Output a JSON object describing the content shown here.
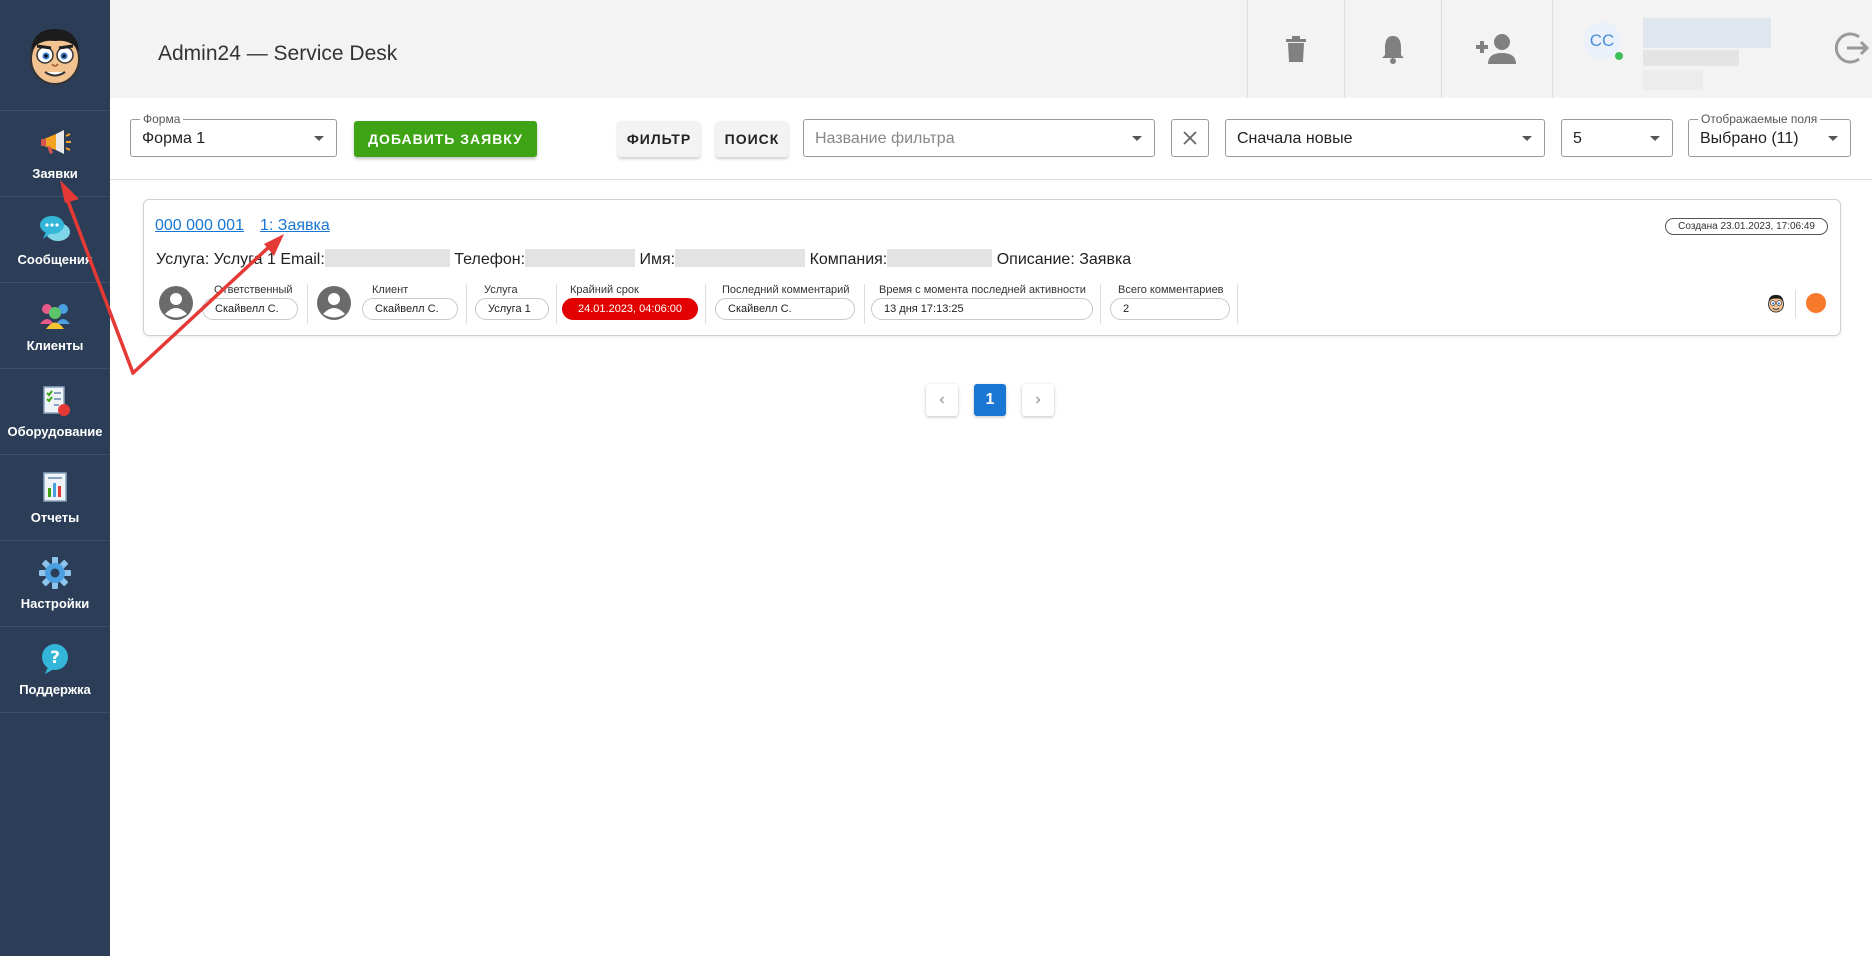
{
  "sidebar": {
    "items": [
      {
        "label": "Заявки"
      },
      {
        "label": "Сообщения"
      },
      {
        "label": "Клиенты"
      },
      {
        "label": "Оборудование"
      },
      {
        "label": "Отчеты"
      },
      {
        "label": "Настройки"
      },
      {
        "label": "Поддержка"
      }
    ]
  },
  "header": {
    "title": "Admin24 — Service Desk",
    "user_initials": "CC"
  },
  "toolbar": {
    "form_legend": "Форма",
    "form_value": "Форма 1",
    "add_button": "ДОБАВИТЬ ЗАЯВКУ",
    "filter_button": "ФИЛЬТР",
    "search_button": "ПОИСК",
    "filter_name_placeholder": "Название фильтра",
    "sort_value": "Сначала новые",
    "per_page_value": "5",
    "fields_legend": "Отображаемые поля",
    "fields_value": "Выбрано (11)"
  },
  "ticket": {
    "number": "000 000 001",
    "title": "1: Заявка",
    "created": "Создана 23.01.2023, 17:06:49",
    "info": {
      "service_label": "Услуга:",
      "service_value": "Услуга 1",
      "email_label": "Email:",
      "phone_label": "Телефон:",
      "name_label": "Имя:",
      "company_label": "Компания:",
      "description_label": "Описание:",
      "description_value": "Заявка"
    },
    "meta": {
      "responsible_label": "Ответственный",
      "responsible_value": "Скайвелл С.",
      "client_label": "Клиент",
      "client_value": "Скайвелл С.",
      "service_label": "Услуга",
      "service_value": "Услуга 1",
      "deadline_label": "Крайний срок",
      "deadline_value": "24.01.2023, 04:06:00",
      "last_comment_label": "Последний комментарий",
      "last_comment_value": "Скайвелл С.",
      "since_activity_label": "Время с момента последней активности",
      "since_activity_value": "13 дня 17:13:25",
      "total_comments_label": "Всего комментариев",
      "total_comments_value": "2"
    }
  },
  "pagination": {
    "current": "1",
    "prev": "‹",
    "next": "›"
  },
  "colors": {
    "sidebar_bg": "#2c3e57",
    "accent_green": "#3fa316",
    "link_blue": "#1976d2",
    "deadline_red": "#e20000",
    "status_orange": "#f7792b",
    "annotation_red": "#e53935"
  }
}
